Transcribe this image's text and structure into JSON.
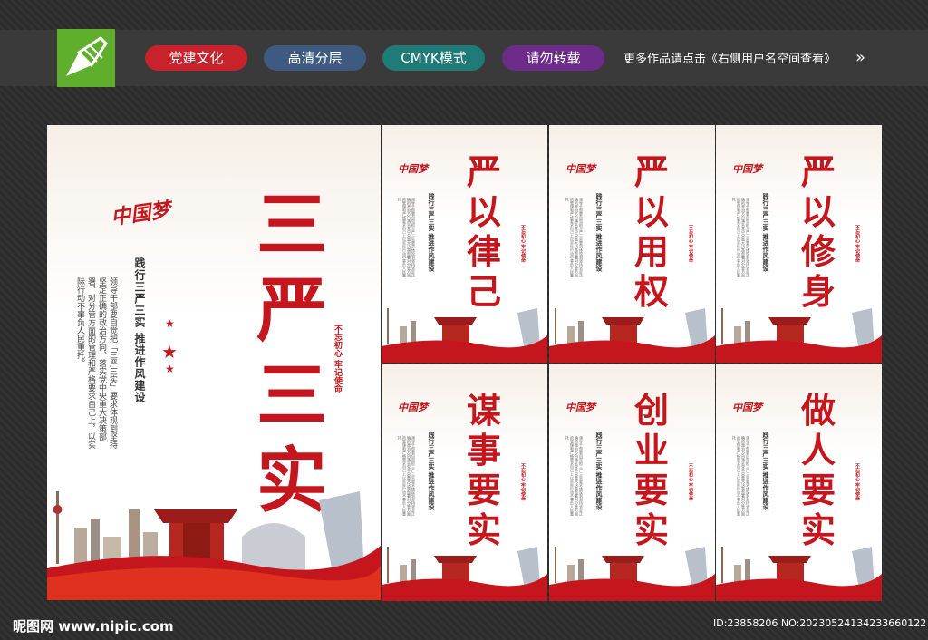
{
  "tags": [
    "党建文化",
    "高清分层",
    "CMYK模式",
    "请勿转载"
  ],
  "note": "更多作品请点击《右侧用户名空间查看》",
  "arrows": "»",
  "big": {
    "title": [
      "三",
      "严",
      "三",
      "实"
    ],
    "slogan": "践行三严三实 推进作风建设",
    "body": "领导干部要自觉把「三严三实」要求体现到坚持坚定正确的政治方向、落实党中央重大决策部署、对分管方面的管理和严格要求自己上，以实际行动不辜负人民重托。",
    "seal": "不忘初心 牢记使命",
    "brand": "中国梦"
  },
  "small_posters": [
    {
      "title": [
        "严",
        "以",
        "律",
        "己"
      ]
    },
    {
      "title": [
        "严",
        "以",
        "用",
        "权"
      ]
    },
    {
      "title": [
        "严",
        "以",
        "修",
        "身"
      ]
    },
    {
      "title": [
        "谋",
        "事",
        "要",
        "实"
      ]
    },
    {
      "title": [
        "创",
        "业",
        "要",
        "实"
      ]
    },
    {
      "title": [
        "做",
        "人",
        "要",
        "实"
      ]
    }
  ],
  "small_common": {
    "slogan": "践行三严三实 推进作风建设",
    "seal": "不忘初心 牢记使命",
    "brand": "中国梦",
    "body": "领导干部要自觉把三严三实要求体现到坚持坚定正确的政治方向落实党中央重大决策部署对分管方面的管理和严格要求自己上以实际行动不辜负人民重托"
  },
  "footer": {
    "left": "昵图网 www.nipic.com",
    "right": "ID:23858206 NO:20230524134233660122"
  },
  "colors": {
    "accent": "#c4161c",
    "logo": "#5fae2c"
  }
}
